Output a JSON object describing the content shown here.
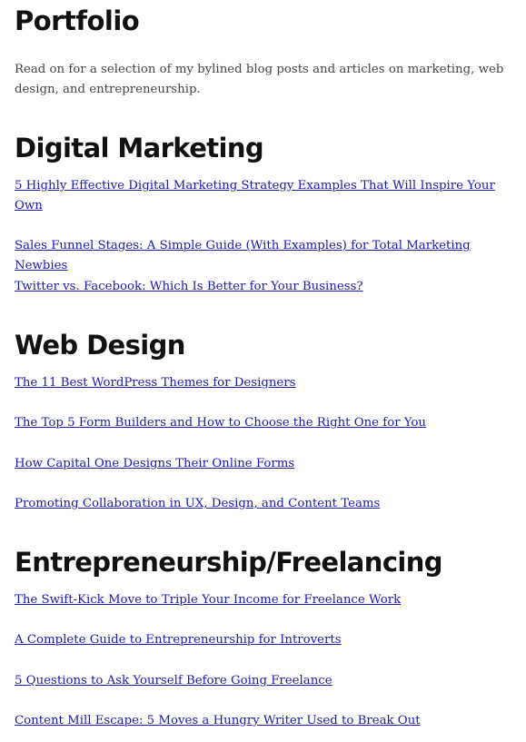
{
  "page": {
    "title": "Portfolio",
    "intro": "Read on for a selection of my bylined blog posts and articles on marketing, web design, and entrepreneurship."
  },
  "sections": [
    {
      "title": "Digital Marketing",
      "links": [
        "5 Highly Effective Digital Marketing Strategy Examples That Will Inspire Your Own",
        "Sales Funnel Stages: A Simple Guide (With Examples) for Total Marketing Newbies",
        "Twitter vs. Facebook: Which Is Better for Your Business?"
      ]
    },
    {
      "title": "Web Design",
      "links": [
        "The 11 Best WordPress Themes for Designers",
        "The Top 5 Form Builders and How to Choose the Right One for You",
        "How Capital One Designs Their Online Forms",
        "Promoting Collaboration in UX, Design, and Content Teams"
      ]
    },
    {
      "title": "Entrepreneurship/Freelancing",
      "links": [
        "The Swift-Kick Move to Triple Your Income for Freelance Work",
        "A Complete Guide to Entrepreneurship for Introverts",
        "5 Questions to Ask Yourself Before Going Freelance",
        "Content Mill Escape: 5 Moves a Hungry Writer Used to Break Out"
      ]
    }
  ],
  "colors": {
    "heading": "#111111",
    "body_text": "#444444",
    "link": "#1a1ab4",
    "background": "#ffffff"
  }
}
